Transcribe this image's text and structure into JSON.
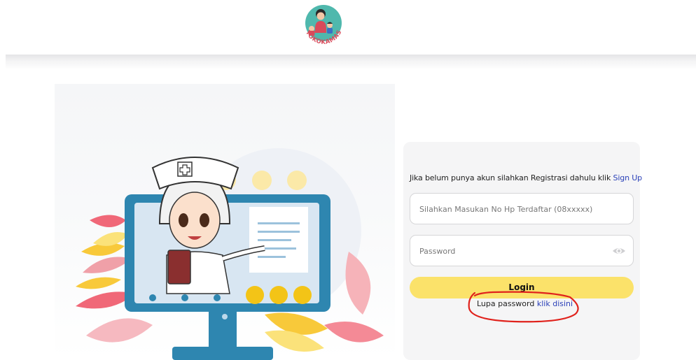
{
  "header": {
    "logo_text": "TOKOKAMAS",
    "logo_icon": "mother-child-logo"
  },
  "login": {
    "signup_prompt": "Jika belum punya akun silahkan Registrasi dahulu klik",
    "signup_link": "Sign Up",
    "phone_placeholder": "Silahkan Masukan No Hp Terdaftar (08xxxxx)",
    "phone_value": "",
    "password_placeholder": "Password",
    "password_value": "",
    "password_toggle_icon": "eye-icon",
    "login_label": "Login",
    "forgot_prompt": "Lupa password",
    "forgot_link": "klik disini"
  },
  "colors": {
    "accent_yellow": "#fbe26a",
    "link_blue": "#2a40b8",
    "annotation_red": "#e0221c",
    "monitor_blue": "#2e86b0"
  }
}
